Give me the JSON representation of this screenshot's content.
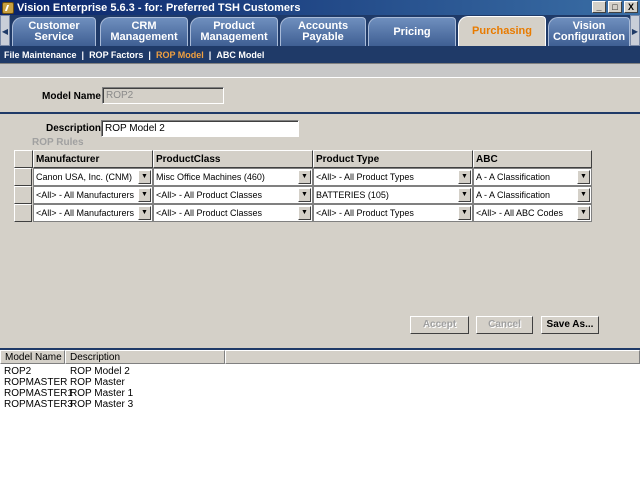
{
  "window": {
    "title": "Vision Enterprise 5.6.3 - for:  Preferred TSH Customers",
    "buttons": [
      "_",
      "□",
      "X"
    ]
  },
  "modules": [
    {
      "label": "Customer\nService",
      "active": false
    },
    {
      "label": "CRM\nManagement",
      "active": false
    },
    {
      "label": "Product\nManagement",
      "active": false
    },
    {
      "label": "Accounts\nPayable",
      "active": false
    },
    {
      "label": "Pricing",
      "active": false
    },
    {
      "label": "Purchasing",
      "active": true
    },
    {
      "label": "Vision\nConfiguration",
      "active": false
    }
  ],
  "subnav": {
    "items": [
      "File Maintenance",
      "ROP Factors",
      "ROP Model",
      "ABC Model"
    ],
    "active": "ROP Model",
    "separator": "|"
  },
  "form": {
    "model_name_label": "Model Name",
    "model_name_value": "ROP2",
    "description_label": "Description",
    "description_value": "ROP Model 2",
    "rules_title": "ROP Rules"
  },
  "rules": {
    "headers": [
      "Manufacturer",
      "ProductClass",
      "Product Type",
      "ABC"
    ],
    "rows": [
      [
        "Canon USA, Inc. (CNM)",
        "Misc Office Machines (460)",
        "<All> - All Product Types",
        "A - A Classification"
      ],
      [
        "<All> - All Manufacturers",
        "<All> - All Product Classes",
        "BATTERIES (105)",
        "A - A Classification"
      ],
      [
        "<All> - All Manufacturers",
        "<All> - All Product Classes",
        "<All> - All Product Types",
        "<All> - All ABC Codes"
      ]
    ]
  },
  "actions": {
    "accept": "Accept",
    "cancel": "Cancel",
    "save_as": "Save As..."
  },
  "models_list": {
    "headers": [
      "Model Name",
      "Description"
    ],
    "rows": [
      [
        "ROP2",
        "ROP Model 2"
      ],
      [
        "ROPMASTER",
        "ROP Master"
      ],
      [
        "ROPMASTER1",
        "ROP Master 1"
      ],
      [
        "ROPMASTER3",
        "ROP Master 3"
      ]
    ]
  },
  "colors": {
    "accent_orange": "#e87b00",
    "nav_blue": "#1f3a68"
  }
}
